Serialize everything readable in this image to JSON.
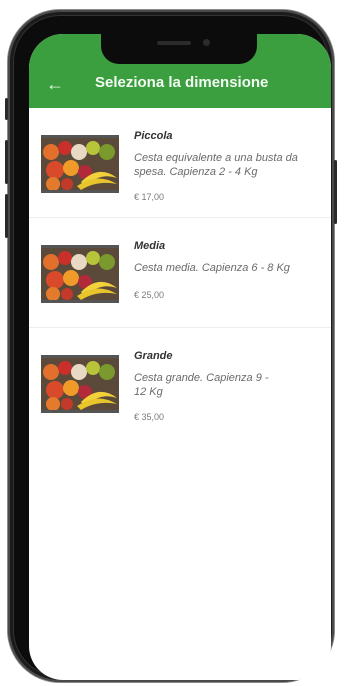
{
  "app_bar": {
    "back_icon": "arrow-left-icon",
    "title": "Seleziona la dimensione",
    "color": "#3c9f3f"
  },
  "products": [
    {
      "name": "Piccola",
      "description": "Cesta equivalente a una busta da spesa. Capienza 2 - 4 Kg",
      "price": "€ 17,00",
      "image": "fruit-basket-image"
    },
    {
      "name": "Media",
      "description": "Cesta media. Capienza 6 - 8 Kg",
      "price": "€ 25,00",
      "image": "fruit-basket-image"
    },
    {
      "name": "Grande",
      "description": "Cesta grande. Capienza 9 - 12 Kg",
      "price": "€ 35,00",
      "image": "fruit-basket-image"
    }
  ]
}
